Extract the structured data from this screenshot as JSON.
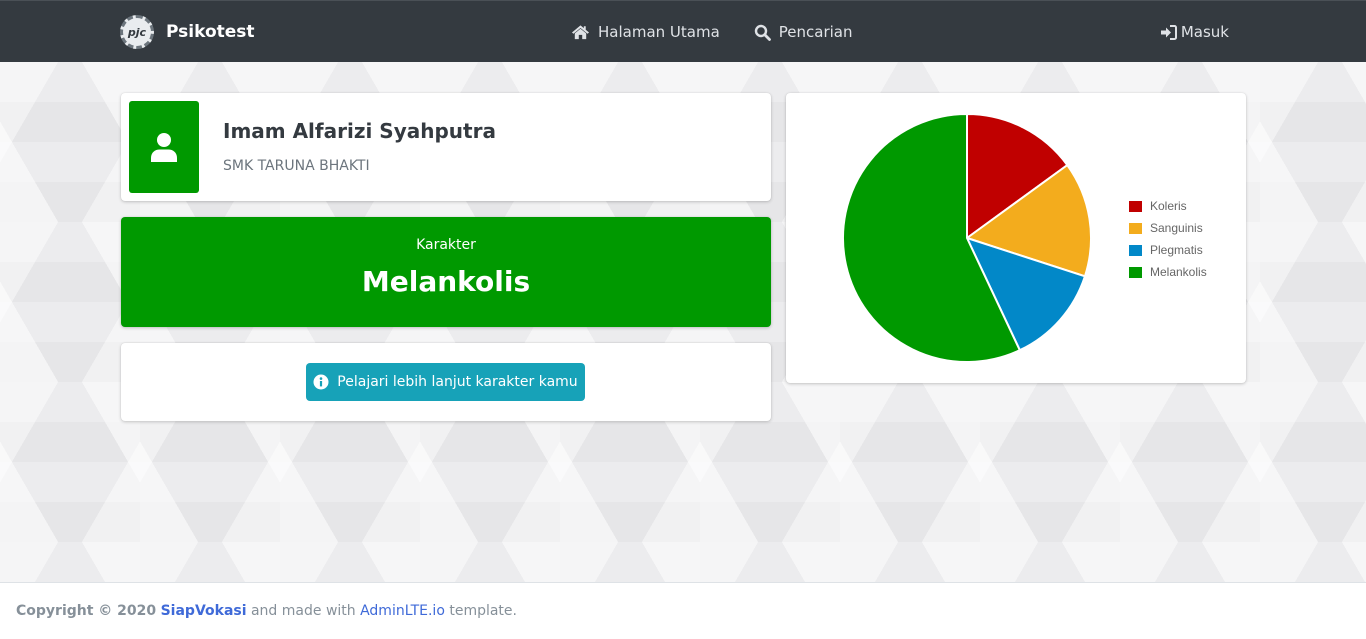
{
  "navbar": {
    "brand_logo_text": "pjc",
    "brand": "Psikotest",
    "links": [
      {
        "label": "Halaman Utama",
        "icon": "home-icon"
      },
      {
        "label": "Pencarian",
        "icon": "search-icon"
      }
    ],
    "login": {
      "label": "Masuk",
      "icon": "sign-in-icon"
    }
  },
  "profile": {
    "icon": "user-icon",
    "name": "Imam Alfarizi Syahputra",
    "school": "SMK TARUNA BHAKTI"
  },
  "result": {
    "label": "Karakter",
    "value": "Melankolis"
  },
  "action": {
    "button_label": "Pelajari lebih lanjut karakter kamu",
    "icon": "info-circle-icon"
  },
  "chart_data": {
    "type": "pie",
    "categories": [
      "Koleris",
      "Sanguinis",
      "Plegmatis",
      "Melankolis"
    ],
    "values": [
      15,
      15,
      13,
      57
    ],
    "colors": [
      "#c00000",
      "#f3ac1d",
      "#0288c8",
      "#009900"
    ],
    "legend": "right"
  },
  "footer": {
    "copyright": "Copyright © 2020",
    "org": "SiapVokasi",
    "middle": " and made with ",
    "tool": "AdminLTE.io",
    "suffix": " template."
  },
  "colors": {
    "navbar": "#343a40",
    "success": "#009900",
    "info": "#17a2b8"
  }
}
